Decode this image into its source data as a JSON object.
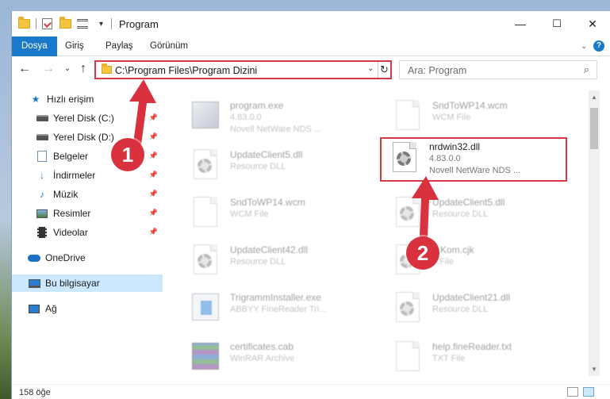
{
  "window": {
    "title": "Program",
    "quick_access_dropdown": "▾",
    "minimize": "—",
    "maximize": "☐",
    "close": "✕"
  },
  "ribbon": {
    "tabs": [
      "Dosya",
      "Giriş",
      "Paylaş",
      "Görünüm"
    ],
    "active_tab": "Dosya",
    "collapse": "⌄",
    "help": "?"
  },
  "navigation": {
    "back": "←",
    "forward": "→",
    "recent": "⌄",
    "up": "↑",
    "address_path": "C:\\Program Files\\Program Dizini",
    "address_dropdown": "⌄",
    "refresh": "↻",
    "search_placeholder": "Ara: Program",
    "search_icon": "⌕"
  },
  "sidebar": {
    "items": [
      {
        "label": "Hızlı erişim",
        "icon": "star-icon",
        "pinned": false
      },
      {
        "label": "Yerel Disk (C:)",
        "icon": "drive-icon",
        "pinned": true
      },
      {
        "label": "Yerel Disk (D:)",
        "icon": "drive-icon",
        "pinned": true
      },
      {
        "label": "Belgeler",
        "icon": "documents-icon",
        "pinned": true
      },
      {
        "label": "İndirmeler",
        "icon": "download-icon",
        "pinned": true
      },
      {
        "label": "Müzik",
        "icon": "music-icon",
        "pinned": true
      },
      {
        "label": "Resimler",
        "icon": "pictures-icon",
        "pinned": true
      },
      {
        "label": "Videolar",
        "icon": "videos-icon",
        "pinned": true
      },
      {
        "label": "OneDrive",
        "icon": "cloud-icon",
        "pinned": false
      },
      {
        "label": "Bu bilgisayar",
        "icon": "computer-icon",
        "pinned": false
      },
      {
        "label": "Ağ",
        "icon": "network-icon",
        "pinned": false
      }
    ],
    "pin_glyph": "📌"
  },
  "files": [
    {
      "name": "program.exe",
      "line2": "4.83.0.0",
      "line3": "Novell NetWare NDS ...",
      "icon": "exe"
    },
    {
      "name": "SndToWP14.wcm",
      "line2": "WCM File",
      "line3": "",
      "icon": "page"
    },
    {
      "name": "UpdateClient5.dll",
      "line2": "Resource DLL",
      "line3": "",
      "icon": "dll"
    },
    {
      "name": "SndToWP14.wcm",
      "line2": "WCM File",
      "line3": "",
      "icon": "page"
    },
    {
      "name": "UpdateClient5.dll",
      "line2": "Resource DLL",
      "line3": "",
      "icon": "dll"
    },
    {
      "name": "UpdateClient42.dll",
      "line2": "Resource DLL",
      "line3": "",
      "icon": "dll"
    },
    {
      "name": "...Kom.cjk",
      "line2": "...File",
      "line3": "",
      "icon": "dll"
    },
    {
      "name": "TrigrammInstaller.exe",
      "line2": "ABBYY FineReader Tri...",
      "line3": "",
      "icon": "msi"
    },
    {
      "name": "UpdateClient21.dll",
      "line2": "Resource DLL",
      "line3": "",
      "icon": "dll"
    },
    {
      "name": "certificates.cab",
      "line2": "WinRAR Archive",
      "line3": "",
      "icon": "cab"
    },
    {
      "name": "help.fineReader.txt",
      "line2": "TXT File",
      "line3": "",
      "icon": "page"
    }
  ],
  "highlighted_file": {
    "name": "nrdwin32.dll",
    "version": "4.83.0.0",
    "description": "Novell NetWare NDS ..."
  },
  "status": {
    "item_count": "158 öğe"
  },
  "callouts": {
    "step1": "1",
    "step2": "2",
    "color": "#d9323e"
  }
}
